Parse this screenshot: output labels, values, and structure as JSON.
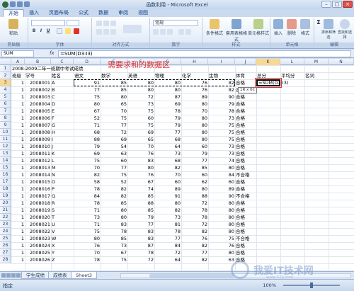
{
  "window": {
    "title": "函数利用 - Microsoft Excel",
    "close": "×",
    "min": "–",
    "max": "□"
  },
  "tabs": [
    "开始",
    "插入",
    "页面布局",
    "公式",
    "数据",
    "审阅",
    "视图"
  ],
  "ribbon": {
    "paste": "粘贴",
    "font_group": "字体",
    "align_group": "对齐方式",
    "number_group": "数字",
    "number_format": "常规",
    "style_group": "样式",
    "cond_format": "条件格式",
    "table_format": "套用表格格式",
    "cell_style": "单元格样式",
    "cells_group": "单元格",
    "insert": "插入",
    "delete": "删除",
    "format": "格式",
    "edit_group": "编辑",
    "sort_filter": "排序和筛选",
    "find_select": "查找和选择",
    "clipboard_group": "剪贴板",
    "bold": "B",
    "italic": "I",
    "underline": "U",
    "sigma": "Σ"
  },
  "formula_bar": {
    "name_box": "SUM",
    "fx": "fx",
    "formula": "=SUM(D3:I3)"
  },
  "columns": [
    "A",
    "B",
    "C",
    "D",
    "E",
    "F",
    "G",
    "H",
    "I",
    "J",
    "K",
    "L",
    "M",
    "N"
  ],
  "rows_visible": [
    "1",
    "2",
    "3",
    "4",
    "5",
    "6",
    "7",
    "8",
    "9",
    "10",
    "11",
    "12",
    "13",
    "14",
    "15",
    "16",
    "17",
    "18",
    "19",
    "20",
    "21",
    "22",
    "23",
    "24",
    "25",
    "26",
    "27",
    "28"
  ],
  "sheet": {
    "title": "2008-2009二年一班期中考试成绩",
    "headers": [
      "班级",
      "学号",
      "姓名",
      "语文",
      "数学",
      "英语",
      "物理",
      "化学",
      "生物",
      "体育",
      "总分",
      "平均分",
      "名词"
    ],
    "rows": [
      [
        "1",
        "2008001",
        "A",
        "91",
        "85",
        "80",
        "80",
        "76",
        "82",
        "合格"
      ],
      [
        "1",
        "2008002",
        "B",
        "77",
        "85",
        "80",
        "80",
        "76",
        "82",
        "合格"
      ],
      [
        "1",
        "2008003",
        "C",
        "75",
        "80",
        "72",
        "87",
        "89",
        "90",
        "合格"
      ],
      [
        "1",
        "2008004",
        "D",
        "80",
        "65",
        "73",
        "69",
        "80",
        "79",
        "合格"
      ],
      [
        "1",
        "2008005",
        "E",
        "67",
        "70",
        "75",
        "78",
        "70",
        "78",
        "合格"
      ],
      [
        "1",
        "2008006",
        "F",
        "52",
        "75",
        "60",
        "79",
        "80",
        "73",
        "合格"
      ],
      [
        "1",
        "2008007",
        "G",
        "71",
        "77",
        "75",
        "79",
        "80",
        "75",
        "合格"
      ],
      [
        "1",
        "2008008",
        "H",
        "68",
        "72",
        "69",
        "77",
        "80",
        "75",
        "合格"
      ],
      [
        "1",
        "2008009",
        "I",
        "88",
        "69",
        "65",
        "68",
        "80",
        "75",
        "合格"
      ],
      [
        "1",
        "2008010",
        "J",
        "79",
        "54",
        "70",
        "64",
        "60",
        "73",
        "合格"
      ],
      [
        "1",
        "2008011",
        "K",
        "69",
        "63",
        "76",
        "73",
        "79",
        "73",
        "合格"
      ],
      [
        "1",
        "2008012",
        "L",
        "75",
        "60",
        "83",
        "68",
        "77",
        "74",
        "合格"
      ],
      [
        "1",
        "2008013",
        "M",
        "70",
        "77",
        "80",
        "82",
        "85",
        "80",
        "合格"
      ],
      [
        "1",
        "2008014",
        "N",
        "82",
        "75",
        "76",
        "70",
        "60",
        "84",
        "不合格"
      ],
      [
        "1",
        "2008015",
        "O",
        "58",
        "52",
        "67",
        "60",
        "62",
        "60",
        "合格"
      ],
      [
        "1",
        "2008016",
        "P",
        "78",
        "82",
        "74",
        "89",
        "80",
        "89",
        "合格"
      ],
      [
        "1",
        "2008017",
        "Q",
        "84",
        "82",
        "85",
        "91",
        "88",
        "90",
        "不合格"
      ],
      [
        "1",
        "2008018",
        "R",
        "78",
        "85",
        "88",
        "80",
        "72",
        "80",
        "合格"
      ],
      [
        "1",
        "2008019",
        "S",
        "71",
        "80",
        "85",
        "82",
        "78",
        "80",
        "合格"
      ],
      [
        "1",
        "2008020",
        "T",
        "73",
        "80",
        "79",
        "73",
        "78",
        "80",
        "合格"
      ],
      [
        "1",
        "2008021",
        "U",
        "71",
        "83",
        "77",
        "81",
        "72",
        "80",
        "合格"
      ],
      [
        "1",
        "2008022",
        "V",
        "75",
        "78",
        "83",
        "78",
        "82",
        "80",
        "合格"
      ],
      [
        "1",
        "2008023",
        "W",
        "80",
        "85",
        "83",
        "77",
        "76",
        "75",
        "不合格"
      ],
      [
        "1",
        "2008024",
        "X",
        "76",
        "73",
        "87",
        "84",
        "82",
        "76",
        "合格"
      ],
      [
        "1",
        "2008025",
        "Y",
        "70",
        "67",
        "78",
        "72",
        "77",
        "80",
        "合格"
      ],
      [
        "1",
        "2008026",
        "Z",
        "78",
        "75",
        "72",
        "64",
        "82",
        "63",
        "合格"
      ]
    ],
    "active_formula": "=SUM(D3:I3)",
    "tooltip": "1R x 6C",
    "annotation": "需要求和的数据区"
  },
  "sheet_tabs": [
    "学生成绩",
    "成绩表",
    "Sheet3"
  ],
  "status": {
    "mode": "指定",
    "zoom": "100%"
  },
  "watermark": {
    "text": "我爱IT技术网",
    "sub": "www.52ij.com"
  }
}
